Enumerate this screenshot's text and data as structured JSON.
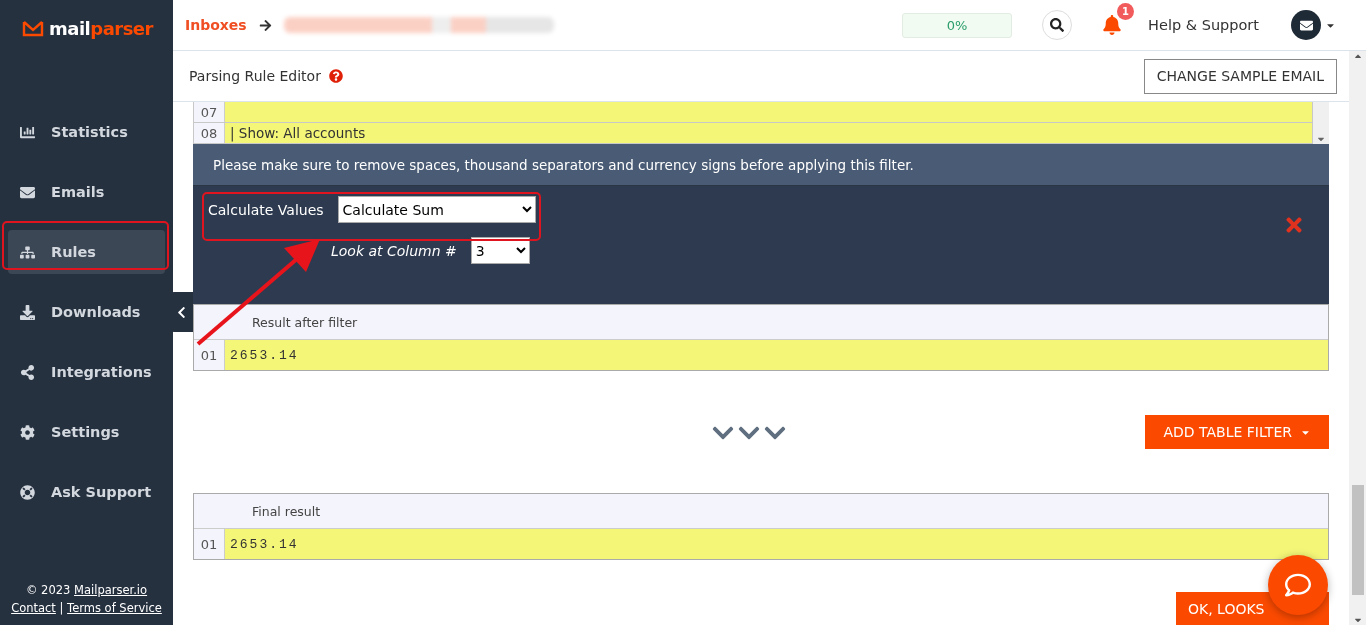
{
  "brand": {
    "first": "mail",
    "second": "parser"
  },
  "sidebar": {
    "items": [
      {
        "label": "Statistics",
        "selected": false
      },
      {
        "label": "Emails",
        "selected": false
      },
      {
        "label": "Rules",
        "selected": true
      },
      {
        "label": "Downloads",
        "selected": false
      },
      {
        "label": "Integrations",
        "selected": false
      },
      {
        "label": "Settings",
        "selected": false
      },
      {
        "label": "Ask Support",
        "selected": false
      }
    ],
    "footer": {
      "copyright": "© 2023",
      "site_link": "Mailparser.io",
      "contact_link": "Contact",
      "separator": "|",
      "terms_link": "Terms of Service"
    }
  },
  "topbar": {
    "breadcrumb": "Inboxes",
    "progress": {
      "text": "0%",
      "level": 0
    },
    "notifications": "1",
    "help": "Help & Support"
  },
  "subheader": {
    "title": "Parsing Rule Editor",
    "button": "CHANGE SAMPLE EMAIL"
  },
  "source_rows": [
    {
      "number": "07",
      "text": ""
    },
    {
      "number": "08",
      "text": "| Show: All accounts"
    }
  ],
  "notice": "Please make sure to remove spaces, thousand separators and currency signs before applying this filter.",
  "filter": {
    "label": "Calculate Values",
    "value": "Calculate Sum",
    "column_label": "Look at Column #",
    "column_value": "3"
  },
  "result_after_filter": {
    "title": "Result after filter",
    "rows": [
      {
        "number": "01",
        "text": "2653.14"
      }
    ]
  },
  "add_filter_button": "ADD TABLE FILTER",
  "final_result": {
    "title": "Final result",
    "rows": [
      {
        "number": "01",
        "text": "2653.14"
      }
    ]
  },
  "ok_button": "OK, LOOKS"
}
